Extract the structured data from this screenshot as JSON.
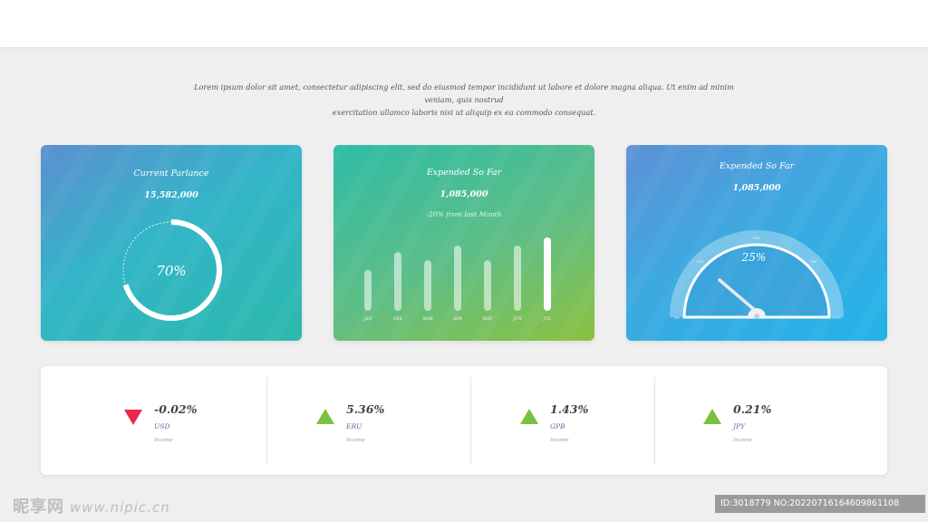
{
  "intro": {
    "line1": "Lorem ipsum dolor sit amet, consectetur adipiscing elit, sed do eiusmod tempor incididunt ut labore et dolore magna aliqua. Ut enim ad minim veniam, quis nostrud",
    "line2": "exercitation ullamco laboris nisi ut aliquip ex ea commodo consequat."
  },
  "cards": {
    "parlance": {
      "title": "Current Parlance",
      "value": "15,582,000",
      "percent_label": "70%",
      "percent": 70
    },
    "expended_bars": {
      "title": "Expended So Far",
      "value": "1,085,000",
      "subtitle": "-20% from last Month"
    },
    "expended_gauge": {
      "title": "Expended So Far",
      "value": "1,085,000",
      "percent_label": "25%",
      "percent": 25
    }
  },
  "chart_data": {
    "type": "bar",
    "categories": [
      "JAN",
      "FEB",
      "MAR",
      "APR",
      "MAY",
      "JUN",
      "JUL"
    ],
    "values": [
      50,
      72,
      62,
      80,
      62,
      80,
      90
    ],
    "highlight_index": 6,
    "ylim": [
      0,
      100
    ]
  },
  "gauge_data": {
    "ticks": [
      "0%",
      "25%",
      "50%",
      "75%",
      "100%"
    ],
    "value": 25,
    "range": [
      0,
      100
    ]
  },
  "stats": [
    {
      "value": "-0.02%",
      "currency": "USD",
      "note": "Income",
      "direction": "down",
      "color": "#e8294a"
    },
    {
      "value": "5.36%",
      "currency": "ERU",
      "note": "Income",
      "direction": "up",
      "color": "#7ac143"
    },
    {
      "value": "1.43%",
      "currency": "GPB",
      "note": "Income",
      "direction": "up",
      "color": "#7ac143"
    },
    {
      "value": "0.21%",
      "currency": "JPY",
      "note": "Income",
      "direction": "up",
      "color": "#7ac143"
    }
  ],
  "watermark": {
    "brand": "昵享网",
    "url": "www.nipic.cn",
    "id_text": "ID:3018779 NO:20220716164609861108"
  }
}
